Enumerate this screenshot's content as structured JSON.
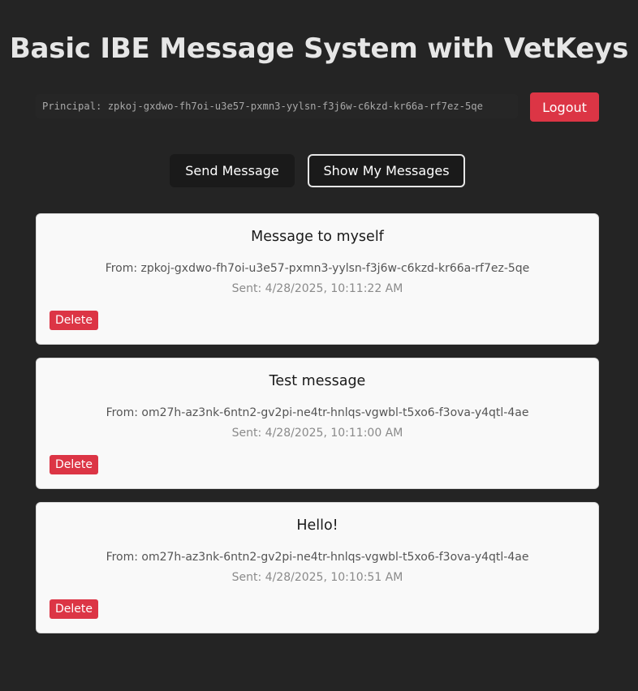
{
  "header": {
    "title": "Basic IBE Message System with VetKeys"
  },
  "account": {
    "principal_label": "Principal:",
    "principal_id": "zpkoj-gxdwo-fh7oi-u3e57-pxmn3-yylsn-f3j6w-c6kzd-kr66a-rf7ez-5qe",
    "principal_text": "Principal: zpkoj-gxdwo-fh7oi-u3e57-pxmn3-yylsn-f3j6w-c6kzd-kr66a-rf7ez-5qe",
    "logout_label": "Logout"
  },
  "nav": {
    "send_label": "Send Message",
    "show_label": "Show My Messages"
  },
  "messages": [
    {
      "title": "Message to myself",
      "from": "From: zpkoj-gxdwo-fh7oi-u3e57-pxmn3-yylsn-f3j6w-c6kzd-kr66a-rf7ez-5qe",
      "sent": "Sent: 4/28/2025, 10:11:22 AM",
      "delete_label": "Delete"
    },
    {
      "title": "Test message",
      "from": "From: om27h-az3nk-6ntn2-gv2pi-ne4tr-hnlqs-vgwbl-t5xo6-f3ova-y4qtl-4ae",
      "sent": "Sent: 4/28/2025, 10:11:00 AM",
      "delete_label": "Delete"
    },
    {
      "title": "Hello!",
      "from": "From: om27h-az3nk-6ntn2-gv2pi-ne4tr-hnlqs-vgwbl-t5xo6-f3ova-y4qtl-4ae",
      "sent": "Sent: 4/28/2025, 10:10:51 AM",
      "delete_label": "Delete"
    }
  ],
  "colors": {
    "background": "#242424",
    "danger": "#dc3545",
    "card": "#f9f9f9",
    "button_dark": "#1a1a1a"
  }
}
